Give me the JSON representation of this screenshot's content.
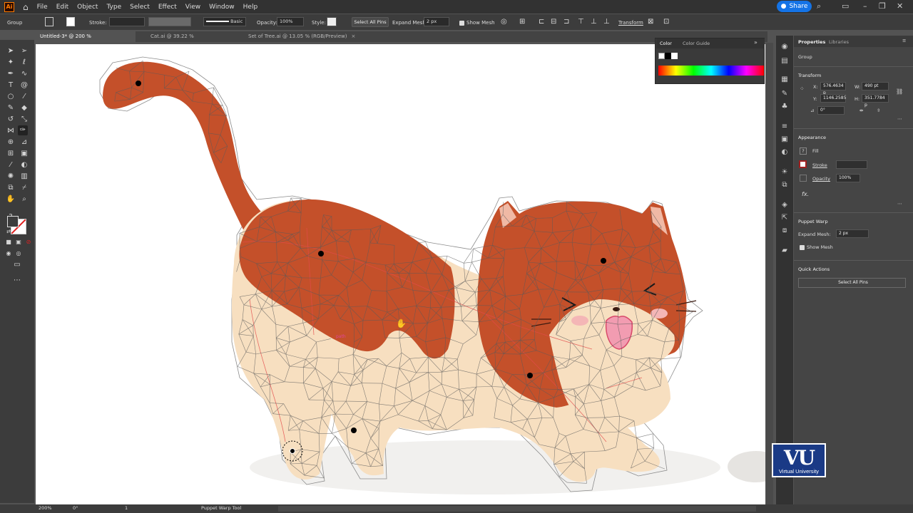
{
  "menubar": {
    "app_logo": "Ai",
    "items": [
      "File",
      "Edit",
      "Object",
      "Type",
      "Select",
      "Effect",
      "View",
      "Window",
      "Help"
    ],
    "share_label": "Share"
  },
  "controlbar": {
    "selection_label": "Group",
    "stroke_label": "Stroke:",
    "brush_label": "Basic",
    "opacity_label": "Opacity:",
    "opacity_value": "100%",
    "style_label": "Style:",
    "select_all_pins": "Select All Pins",
    "expand_mesh_label": "Expand Mesh:",
    "expand_mesh_value": "2 px",
    "show_mesh_label": "Show Mesh",
    "transform_label": "Transform"
  },
  "tabs": [
    {
      "label": "Untitled-3* @ 200 % (CMYK/Preview)"
    },
    {
      "label": "Cat.ai @ 39.22 % (RGB/Preview)"
    },
    {
      "label": "Set of Tree.ai @ 13.05 % (RGB/Preview)"
    }
  ],
  "tab_close": "×",
  "color_panel": {
    "tab_color": "Color",
    "tab_guide": "Color Guide"
  },
  "properties": {
    "tab_properties": "Properties",
    "tab_libraries": "Libraries",
    "group_label": "Group",
    "transform_title": "Transform",
    "x_label": "X:",
    "x_value": "576.4634 p",
    "y_label": "Y:",
    "y_value": "1146.2585",
    "w_label": "W:",
    "w_value": "490 pt",
    "h_label": "H:",
    "h_value": "351.7784 p",
    "angle_value": "0°",
    "appearance_title": "Appearance",
    "fill_label": "Fill",
    "stroke_label": "Stroke",
    "opacity_label": "Opacity",
    "opacity_value": "100%",
    "fx_label": "fx.",
    "puppet_title": "Puppet Warp",
    "expand_mesh_label": "Expand Mesh:",
    "expand_mesh_value": "2 px",
    "show_mesh_label": "Show Mesh",
    "quick_actions_title": "Quick Actions",
    "select_all_pins": "Select All Pins"
  },
  "statusbar": {
    "zoom": "200%",
    "rotation": "0°",
    "artboard": "1",
    "tool": "Puppet Warp Tool"
  },
  "canvas": {
    "path_hint": "path"
  },
  "watermark": {
    "letters": "VU",
    "caption": "Virtual University"
  },
  "colors": {
    "cat_fur": "#c4502a",
    "cat_belly": "#f7dfc0",
    "mesh_line": "#555555",
    "blush": "#f4b6b6",
    "accent_blue": "#1473e6"
  }
}
